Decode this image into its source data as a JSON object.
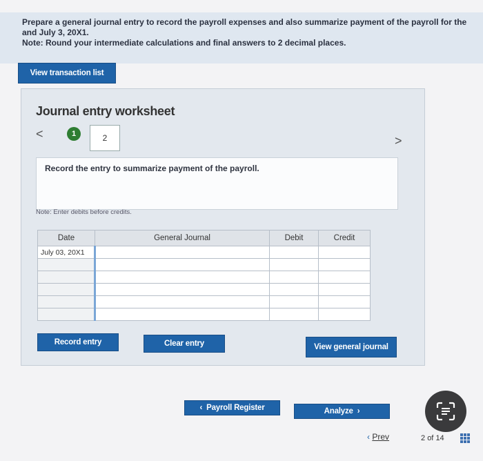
{
  "instructions": {
    "line1": "Prepare a general journal entry to record the payroll expenses and also summarize payment of the payroll for the",
    "line2": "and July 3, 20X1.",
    "line3": "Note: Round your intermediate calculations and final answers to 2 decimal places."
  },
  "view_transactions_label": "View transaction list",
  "worksheet": {
    "title": "Journal entry worksheet",
    "nav_prev": "<",
    "nav_next": ">",
    "steps": [
      "1",
      "2"
    ],
    "description": "Record the entry to summarize payment of the payroll.",
    "note": "Note: Enter debits before credits.",
    "table": {
      "headers": [
        "Date",
        "General Journal",
        "Debit",
        "Credit"
      ],
      "rows": [
        [
          "July 03, 20X1",
          "",
          "",
          ""
        ],
        [
          "",
          "",
          "",
          ""
        ],
        [
          "",
          "",
          "",
          ""
        ],
        [
          "",
          "",
          "",
          ""
        ],
        [
          "",
          "",
          "",
          ""
        ],
        [
          "",
          "",
          "",
          ""
        ]
      ]
    },
    "record_label": "Record entry",
    "clear_label": "Clear entry",
    "view_journal_label": "View general journal"
  },
  "footer": {
    "payroll_register_label": "Payroll Register",
    "analyze_label": "Analyze",
    "prev_label": "Prev",
    "page_current": "2",
    "page_of": "of",
    "page_total": "14"
  },
  "colors": {
    "accent": "#1f63a8",
    "step_done": "#2e7d32"
  }
}
